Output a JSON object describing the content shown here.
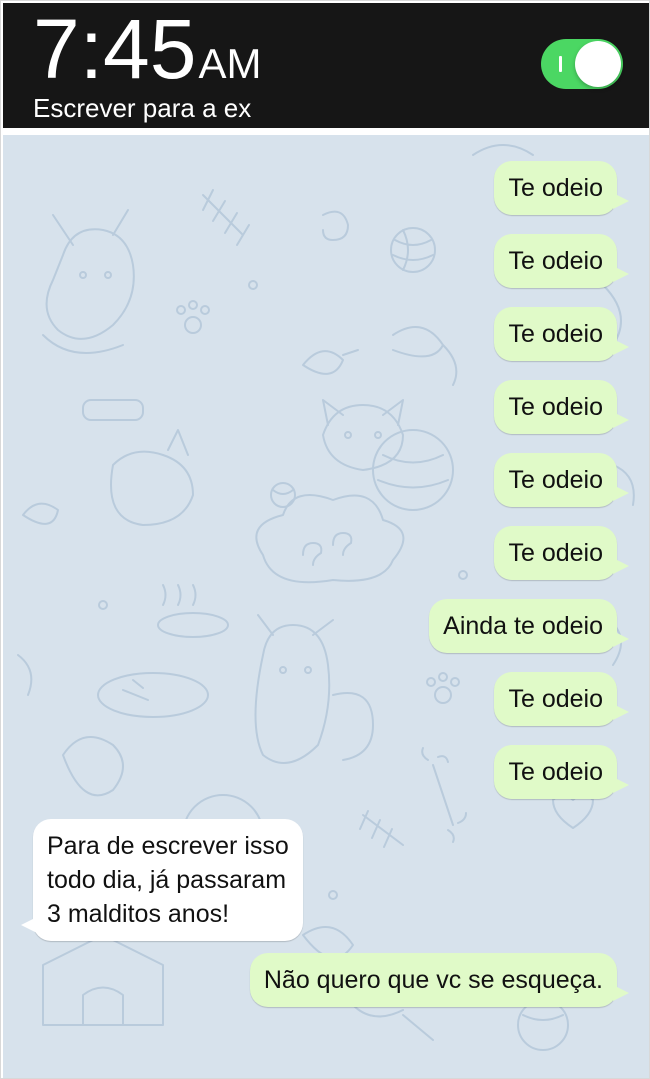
{
  "status": {
    "time_digits": "7:45",
    "time_ampm": "AM",
    "subtitle": "Escrever para a ex"
  },
  "toggle": {
    "state": "on",
    "color": "#4bd763"
  },
  "chat": {
    "background_color": "#d7e2ec",
    "outgoing_color": "#e0fac8",
    "incoming_color": "#ffffff",
    "messages": [
      {
        "direction": "outgoing",
        "text": "Te odeio"
      },
      {
        "direction": "outgoing",
        "text": "Te odeio"
      },
      {
        "direction": "outgoing",
        "text": "Te odeio"
      },
      {
        "direction": "outgoing",
        "text": "Te odeio"
      },
      {
        "direction": "outgoing",
        "text": "Te odeio"
      },
      {
        "direction": "outgoing",
        "text": "Te odeio"
      },
      {
        "direction": "outgoing",
        "text": "Ainda te odeio"
      },
      {
        "direction": "outgoing",
        "text": "Te odeio"
      },
      {
        "direction": "outgoing",
        "text": "Te odeio"
      },
      {
        "direction": "incoming",
        "lines": [
          "Para de escrever isso",
          "todo dia, já passaram",
          "3 malditos anos!"
        ]
      },
      {
        "direction": "outgoing",
        "text": "Não quero que vc se esqueça."
      }
    ]
  }
}
